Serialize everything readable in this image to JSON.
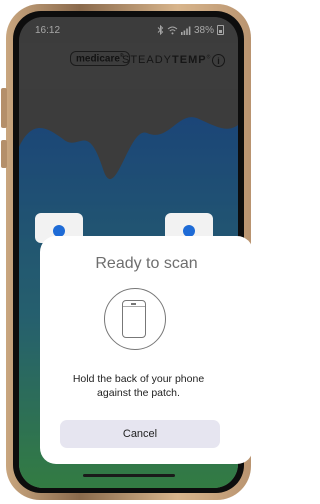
{
  "status_bar": {
    "time": "16:12",
    "bluetooth_icon": "bluetooth-icon",
    "wifi_icon": "wifi-icon",
    "signal_icon": "signal-icon",
    "battery_percent": "38%"
  },
  "header": {
    "brand": "medicare",
    "brand_mark": "®",
    "product_prefix": "STEADY",
    "product_suffix": "TEMP",
    "product_mark": "®",
    "info_icon": "info-icon"
  },
  "scan_sheet": {
    "title": "Ready to scan",
    "illustration": "phone-outline-icon",
    "message_line1": "Hold the back of your phone",
    "message_line2": "against the patch.",
    "cancel_label": "Cancel"
  },
  "colors": {
    "accent_blue": "#1e6bd6",
    "gradient_top": "#2a6bb8",
    "gradient_bottom": "#4fbf66",
    "background_dimmed": "#5c5c5c"
  }
}
